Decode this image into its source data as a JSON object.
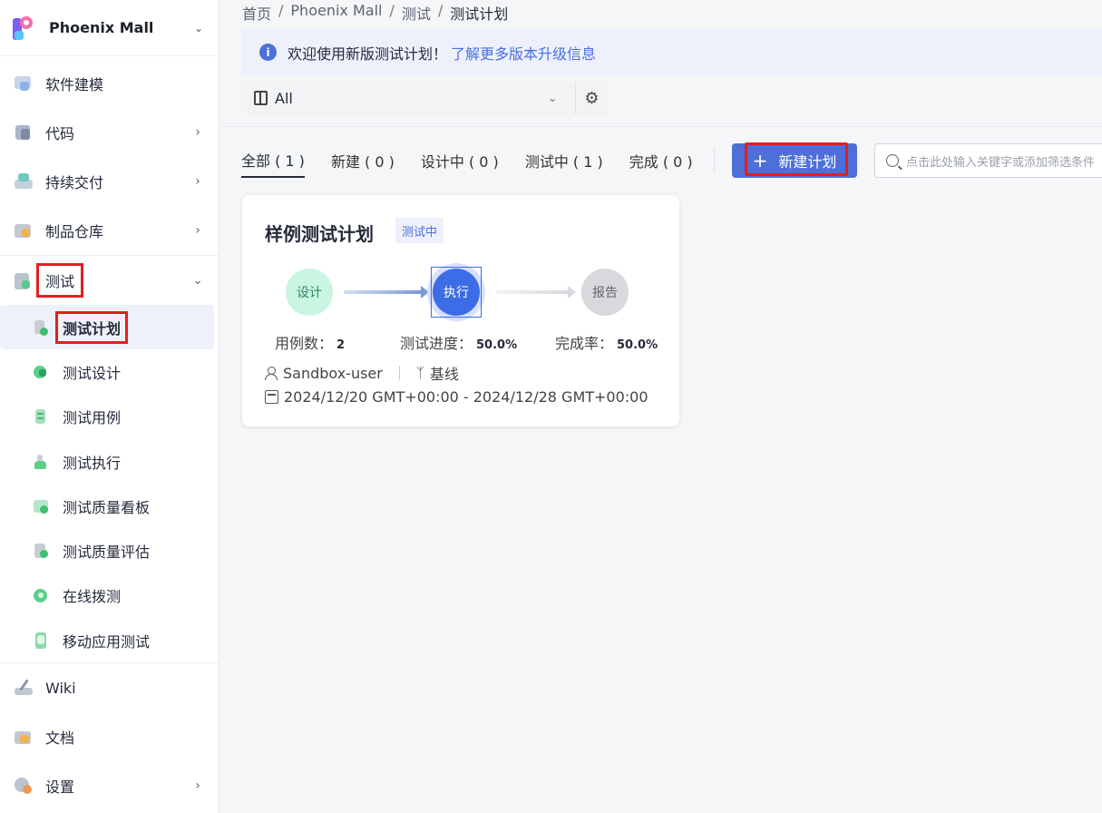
{
  "project": {
    "name": "Phoenix Mall"
  },
  "sidebar": {
    "items": [
      {
        "label": "软件建模",
        "icon": "modeling-icon"
      },
      {
        "label": "代码",
        "icon": "code-icon"
      },
      {
        "label": "持续交付",
        "icon": "delivery-icon"
      },
      {
        "label": "制品仓库",
        "icon": "artifact-icon"
      },
      {
        "label": "测试",
        "icon": "test-icon"
      }
    ],
    "sub_items": [
      {
        "label": "测试计划"
      },
      {
        "label": "测试设计"
      },
      {
        "label": "测试用例"
      },
      {
        "label": "测试执行"
      },
      {
        "label": "测试质量看板"
      },
      {
        "label": "测试质量评估"
      },
      {
        "label": "在线拨测"
      },
      {
        "label": "移动应用测试"
      }
    ],
    "bottom_items": [
      {
        "label": "Wiki"
      },
      {
        "label": "文档"
      },
      {
        "label": "设置"
      }
    ]
  },
  "breadcrumb": [
    "首页",
    "Phoenix Mall",
    "测试",
    "测试计划"
  ],
  "notice": {
    "text": "欢迎使用新版测试计划！",
    "link": "了解更多版本升级信息"
  },
  "filter": {
    "value": "All"
  },
  "tabs": [
    "全部 ( 1 )",
    "新建 ( 0 )",
    "设计中 ( 0 )",
    "测试中 ( 1 )",
    "完成 ( 0 )"
  ],
  "new_button": "新建计划",
  "search": {
    "placeholder": "点击此处输入关键字或添加筛选条件"
  },
  "card": {
    "title": "样例测试计划",
    "status": "测试中",
    "steps": [
      "设计",
      "执行",
      "报告"
    ],
    "cases_label": "用例数：",
    "cases_value": "2",
    "progress_label": "测试进度：",
    "progress_value": "50.0%",
    "completion_label": "完成率：",
    "completion_value": "50.0%",
    "owner": "Sandbox-user",
    "baseline": "基线",
    "date_range": "2024/12/20 GMT+00:00 - 2024/12/28 GMT+00:00"
  },
  "colors": {
    "primary": "#4d6fd8",
    "highlight": "#e02020"
  }
}
